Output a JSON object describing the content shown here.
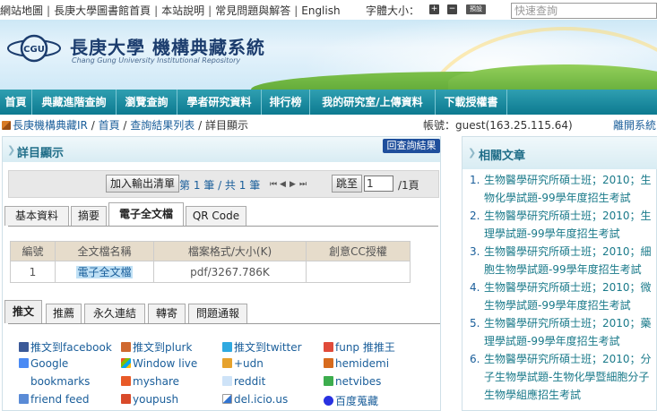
{
  "topbar": {
    "links": [
      "網站地圖",
      "長庚大學圖書館首頁",
      "本站說明",
      "常見問題與解答",
      "English"
    ],
    "font_size_label": "字體大小：",
    "font_up": "+",
    "font_down": "−",
    "font_reset": "預設",
    "quick_search_placeholder": "快速查詢"
  },
  "banner": {
    "title": "長庚大學  機構典藏系統",
    "subtitle": "Chang Gung University Institutional Repository",
    "logo_text": "CGU"
  },
  "nav": [
    "首頁",
    "典藏進階查詢",
    "瀏覽查詢",
    "學者研究資料",
    "排行榜",
    "我的研究室/上傳資料",
    "下載授權書"
  ],
  "breadcrumb": {
    "items": [
      "長庚機構典藏IR",
      "首頁",
      "查詢結果列表",
      "詳目顯示"
    ],
    "account": "帳號：guest(163.25.115.64)",
    "logout": "離開系統"
  },
  "detail": {
    "title": "詳目顯示",
    "back_button": "回查詢結果",
    "add_export": "加入輸出清單",
    "page_count": "第 1 筆 / 共 1 筆",
    "jump": "跳至",
    "jump_value": "1",
    "page_total": "/1頁",
    "tabs": [
      "基本資料",
      "摘要",
      "電子全文檔",
      "QR Code"
    ],
    "active_tab": 2,
    "file_table": {
      "headers": [
        "編號",
        "全文檔名稱",
        "檔案格式/大小(K)",
        "創意CC授權"
      ],
      "rows": [
        {
          "no": "1",
          "name": "電子全文檔",
          "format": "pdf/3267.786K",
          "cc": ""
        }
      ]
    },
    "share_tabs": [
      "推文",
      "推薦",
      "永久連結",
      "轉寄",
      "問題通報"
    ],
    "share_links": [
      "推文到facebook",
      "推文到plurk",
      "推文到twitter",
      "funp 推推王",
      "Google bookmarks",
      "Window live",
      "+udn",
      "hemidemi",
      "myshare",
      "reddit",
      "netvibes",
      "friend feed",
      "youpush",
      "del.icio.us",
      "百度蒐藏"
    ]
  },
  "related": {
    "title": "相關文章",
    "items": [
      {
        "no": "1.",
        "text": "生物醫學研究所碩士班；2010；生物化學試題-99學年度招生考試"
      },
      {
        "no": "2.",
        "text": "生物醫學研究所碩士班；2010；生理學試題-99學年度招生考試"
      },
      {
        "no": "3.",
        "text": "生物醫學研究所碩士班；2010；細胞生物學試題-99學年度招生考試"
      },
      {
        "no": "4.",
        "text": "生物醫學研究所碩士班；2010；微生物學試題-99學年度招生考試"
      },
      {
        "no": "5.",
        "text": "生物醫學研究所碩士班；2010；藥理學試題-99學年度招生考試"
      },
      {
        "no": "6.",
        "text": "生物醫學研究所碩士班；2010；分子生物學試題-生物化學暨細胞分子生物學組應招生考試"
      }
    ]
  },
  "colors": {
    "nav": "#137f95",
    "link": "#1a5e9a",
    "header_text": "#1f6d88",
    "table_head": "#e6dccb"
  }
}
